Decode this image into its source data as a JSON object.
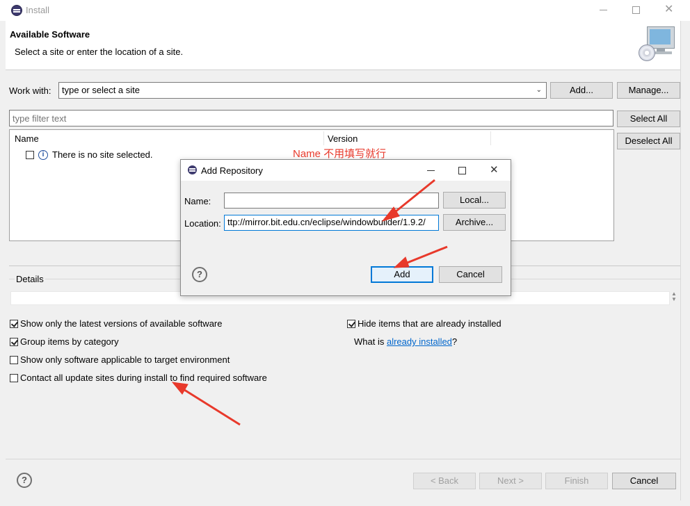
{
  "window": {
    "title": "Install"
  },
  "header": {
    "title": "Available Software",
    "subtitle": "Select a site or enter the location of a site."
  },
  "work_with": {
    "label": "Work with:",
    "value": "type or select a site",
    "add_label": "Add...",
    "manage_label": "Manage..."
  },
  "filter": {
    "placeholder": "type filter text"
  },
  "select_all_label": "Select All",
  "deselect_all_label": "Deselect All",
  "table": {
    "columns": [
      "Name",
      "Version"
    ],
    "empty_message": "There is no site selected."
  },
  "details": {
    "label": "Details"
  },
  "options": {
    "show_latest": "Show only the latest versions of available software",
    "group_by_category": "Group items by category",
    "show_applicable": "Show only software applicable to target environment",
    "contact_all": "Contact all update sites during install to find required software",
    "hide_installed": "Hide items that are already installed",
    "what_is_prefix": "What is ",
    "what_is_link": "already installed",
    "what_is_suffix": "?"
  },
  "footer": {
    "back_label": "< Back",
    "next_label": "Next >",
    "finish_label": "Finish",
    "cancel_label": "Cancel"
  },
  "dialog": {
    "title": "Add Repository",
    "name_label": "Name:",
    "location_label": "Location:",
    "location_value": "ttp://mirror.bit.edu.cn/eclipse/windowbuilder/1.9.2/",
    "local_label": "Local...",
    "archive_label": "Archive...",
    "add_label": "Add",
    "cancel_label": "Cancel"
  },
  "annotation": {
    "text": "Name 不用填写就行",
    "color": "#e8392b"
  }
}
